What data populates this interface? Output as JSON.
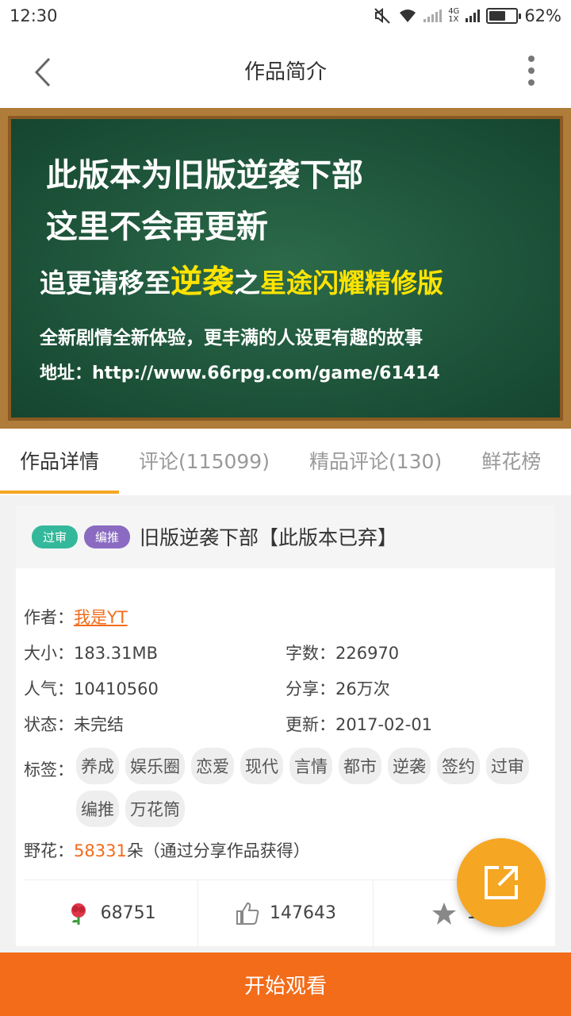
{
  "status_bar": {
    "time": "12:30",
    "battery": "62%",
    "net_top": "4G",
    "net_bottom": "1X",
    "battery_level": 0.62
  },
  "app_bar": {
    "title": "作品简介",
    "back_icon": "chevron-left-icon",
    "more_icon": "more-vertical-icon"
  },
  "banner": {
    "line1": "此版本为旧版逆袭下部",
    "line2": "这里不会再更新",
    "line3_a": "追更请移至",
    "line3_b": "逆袭",
    "line3_c": "之",
    "line3_d": "星途闪耀",
    "line3_e": "精修版",
    "line4": "全新剧情全新体验，更丰满的人设更有趣的故事",
    "line5": "地址：http://www.66rpg.com/game/61414"
  },
  "tabs": [
    {
      "label": "作品详情",
      "active": true
    },
    {
      "label": "评论(115099)"
    },
    {
      "label": "精品评论(130)"
    },
    {
      "label": "鲜花榜"
    }
  ],
  "work": {
    "badge1": "过审",
    "badge2": "编推",
    "title": "旧版逆袭下部【此版本已弃】",
    "author_label": "作者：",
    "author": "我是YT",
    "size_label": "大小：",
    "size": "183.31MB",
    "words_label": "字数：",
    "words": "226970",
    "popularity_label": "人气：",
    "popularity": "10410560",
    "share_label": "分享：",
    "share": "26万次",
    "status_label": "状态：",
    "status": "未完结",
    "update_label": "更新：",
    "update": "2017-02-01",
    "tags_label": "标签：",
    "tags": [
      "养成",
      "娱乐圈",
      "恋爱",
      "现代",
      "言情",
      "都市",
      "逆袭",
      "签约",
      "过审",
      "编推",
      "万花筒"
    ],
    "flower_label": "野花：",
    "flower_count": "58331",
    "flower_suffix": "朵（通过分享作品获得）"
  },
  "stats": {
    "flowers": "68751",
    "likes": "147643",
    "favorites": "16"
  },
  "colors": {
    "accent": "#f26c1a",
    "tab_indicator": "#f5a623",
    "fab": "#f5a623"
  },
  "bottom_button": "开始观看"
}
